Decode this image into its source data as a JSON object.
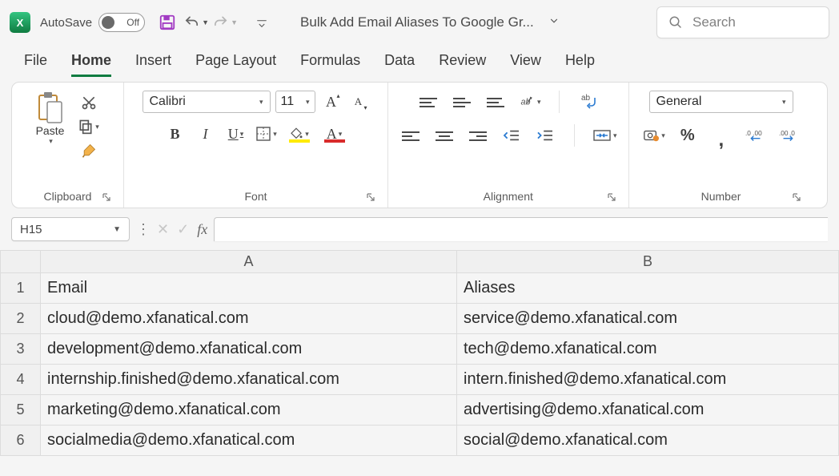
{
  "title": "Bulk Add Email Aliases To Google Gr...",
  "autosave": {
    "label": "AutoSave",
    "state": "Off"
  },
  "search_placeholder": "Search",
  "tabs": [
    "File",
    "Home",
    "Insert",
    "Page Layout",
    "Formulas",
    "Data",
    "Review",
    "View",
    "Help"
  ],
  "active_tab": "Home",
  "ribbon": {
    "clipboard": {
      "label": "Clipboard",
      "paste": "Paste"
    },
    "font": {
      "label": "Font",
      "name": "Calibri",
      "size": "11",
      "bold": "B",
      "italic": "I",
      "underline": "U",
      "A": "A"
    },
    "alignment": {
      "label": "Alignment",
      "wrap": "ab"
    },
    "number": {
      "label": "Number",
      "format": "General",
      "percent": "%",
      "comma": ","
    }
  },
  "namebox": "H15",
  "fx": "fx",
  "columns": [
    "A",
    "B"
  ],
  "headers": {
    "A": "Email",
    "B": "Aliases"
  },
  "rows": [
    {
      "n": 1,
      "A": "Email",
      "B": "Aliases"
    },
    {
      "n": 2,
      "A": "cloud@demo.xfanatical.com",
      "B": "service@demo.xfanatical.com"
    },
    {
      "n": 3,
      "A": "development@demo.xfanatical.com",
      "B": "tech@demo.xfanatical.com"
    },
    {
      "n": 4,
      "A": "internship.finished@demo.xfanatical.com",
      "B": "intern.finished@demo.xfanatical.com"
    },
    {
      "n": 5,
      "A": "marketing@demo.xfanatical.com",
      "B": "advertising@demo.xfanatical.com"
    },
    {
      "n": 6,
      "A": "socialmedia@demo.xfanatical.com",
      "B": "social@demo.xfanatical.com"
    }
  ]
}
